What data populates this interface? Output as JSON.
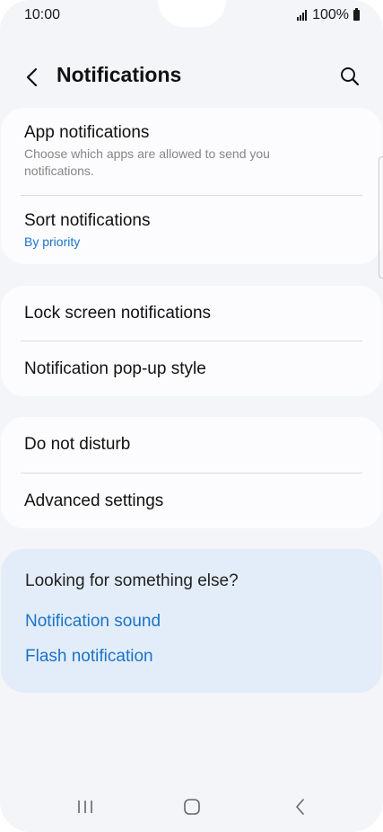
{
  "status_bar": {
    "time": "10:00",
    "battery_text": "100%"
  },
  "header": {
    "title": "Notifications",
    "back_icon": "chevron-left-icon",
    "search_icon": "search-icon"
  },
  "group1": {
    "app_notifications": {
      "title": "App notifications",
      "subtitle": "Choose which apps are allowed to send you notifications."
    },
    "sort_notifications": {
      "title": "Sort notifications",
      "subtitle": "By priority"
    }
  },
  "group2": {
    "lock_screen": {
      "title": "Lock screen notifications"
    },
    "popup_style": {
      "title": "Notification pop-up style"
    }
  },
  "group3": {
    "do_not_disturb": {
      "title": "Do not disturb"
    },
    "advanced": {
      "title": "Advanced settings"
    }
  },
  "suggestions": {
    "title": "Looking for something else?",
    "links": [
      "Notification sound",
      "Flash notification"
    ]
  },
  "colors": {
    "accent": "#1a73c9",
    "background": "#f4f5f8",
    "card": "#fcfcfe",
    "suggest_card": "#e3edf9"
  },
  "nav_bar": {
    "recents_icon": "recents-icon",
    "home_icon": "home-icon",
    "back_icon": "back-icon"
  }
}
